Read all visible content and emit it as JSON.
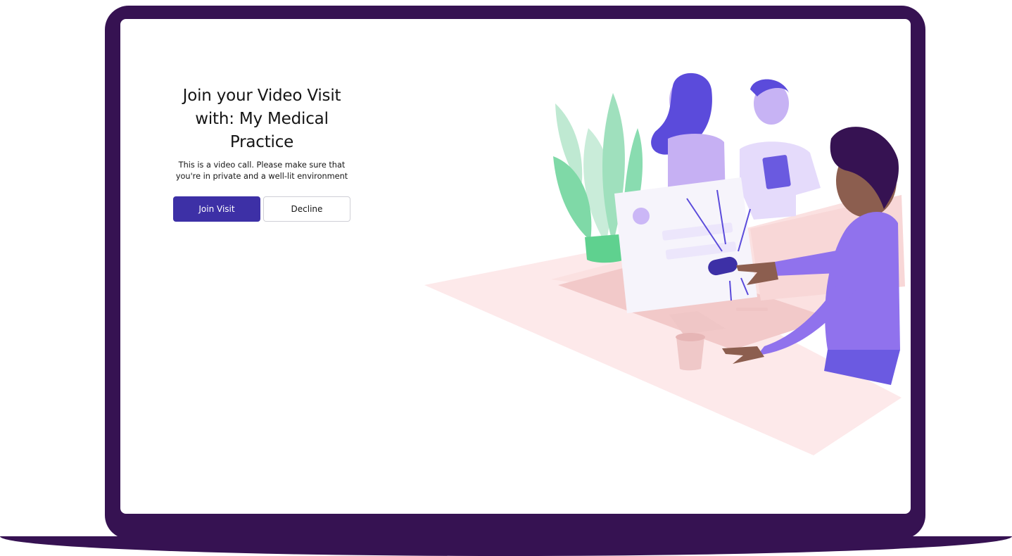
{
  "join": {
    "title_line1": "Join your Video Visit",
    "title_line2": "with: My Medical",
    "title_line3": "Practice",
    "subtitle_line1": "This is a video call. Please make sure that",
    "subtitle_line2": "you're in private and a well-lit environment",
    "join_label": "Join Visit",
    "decline_label": "Decline"
  },
  "colors": {
    "bezel": "#361252",
    "primary": "#3d30a6",
    "illustration_purple": "#6a5ae0",
    "illustration_lavender": "#c8b6f5",
    "illustration_green": "#7ddba8",
    "illustration_pink": "#fde8e8"
  },
  "icons": {
    "illustration": "video-visit-illustration"
  }
}
